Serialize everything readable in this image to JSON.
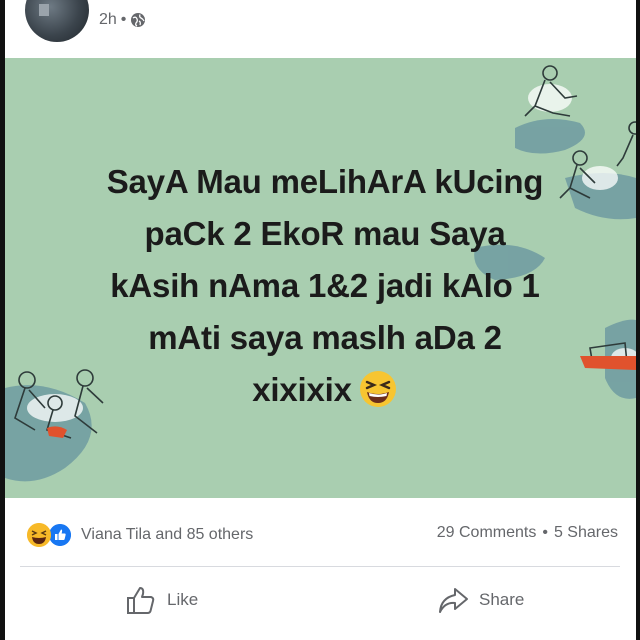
{
  "post": {
    "time": "2h",
    "separator": "•",
    "privacy_icon": "globe-icon"
  },
  "image_text": {
    "line1": "SayA Mau meLihArA kUcing",
    "line2": "paCk 2 EkoR mau Saya",
    "line3": "kAsih nAma 1&2 jadi kAlo 1",
    "line4": "mAti saya maslh aDa 2",
    "line5": "xixixix",
    "emoji": "grinning-squinting-face"
  },
  "stats": {
    "reactors": "Viana Tila and 85 others",
    "comments": "29 Comments",
    "separator": "•",
    "shares": "5 Shares"
  },
  "actions": {
    "like_label": "Like",
    "share_label": "Share"
  },
  "colors": {
    "image_background": "#a9ceb0",
    "like_blue": "#1877f2",
    "haha_yellow": "#f7b928",
    "meta_grey": "#65676b"
  }
}
